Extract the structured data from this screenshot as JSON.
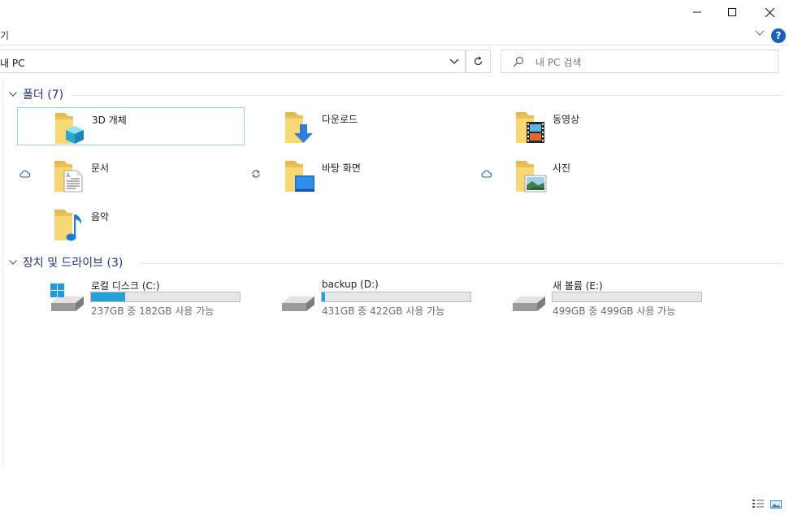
{
  "ribbon": {
    "fragment": "기"
  },
  "address": {
    "path": "내 PC"
  },
  "search": {
    "placeholder": "내 PC 검색"
  },
  "folders_group": {
    "title": "폴더 (7)",
    "items": [
      {
        "label": "3D 개체",
        "icon": "3d-objects-folder-icon"
      },
      {
        "label": "다운로드",
        "icon": "downloads-folder-icon"
      },
      {
        "label": "동영상",
        "icon": "videos-folder-icon"
      },
      {
        "label": "문서",
        "icon": "documents-folder-icon",
        "status": "cloud-icon"
      },
      {
        "label": "바탕 화면",
        "icon": "desktop-folder-icon",
        "status": "sync-icon"
      },
      {
        "label": "사진",
        "icon": "pictures-folder-icon",
        "status": "cloud-icon"
      },
      {
        "label": "음악",
        "icon": "music-folder-icon"
      }
    ]
  },
  "drives_group": {
    "title": "장치 및 드라이브 (3)",
    "items": [
      {
        "label": "로컬 디스크 (C:)",
        "space": "237GB 중 182GB 사용 가능",
        "used_fraction": 0.23
      },
      {
        "label": "backup (D:)",
        "space": "431GB 중 422GB 사용 가능",
        "used_fraction": 0.02
      },
      {
        "label": "새 볼륨 (E:)",
        "space": "499GB 중 499GB 사용 가능",
        "used_fraction": 0.0
      }
    ]
  },
  "colors": {
    "accent": "#26a0da",
    "group_title": "#1e3287",
    "selection_border": "#99d1ec",
    "folder_yellow": "#f8d775",
    "help_blue": "#1b5fbd"
  }
}
